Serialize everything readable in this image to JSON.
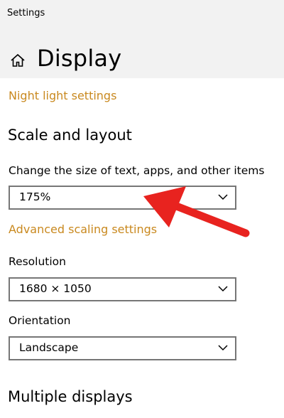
{
  "window": {
    "title": "Settings"
  },
  "header": {
    "title": "Display",
    "home_icon": "home-icon"
  },
  "links": {
    "night_light": "Night light settings",
    "advanced_scaling": "Advanced scaling settings"
  },
  "scale_layout": {
    "section_title": "Scale and layout",
    "scale_label": "Change the size of text, apps, and other items",
    "scale_value": "175%",
    "resolution_label": "Resolution",
    "resolution_value": "1680 × 1050",
    "orientation_label": "Orientation",
    "orientation_value": "Landscape"
  },
  "multiple_displays": {
    "section_title": "Multiple displays"
  },
  "colors": {
    "accent": "#c9891f",
    "header_bg": "#f2f2f2",
    "dropdown_border": "#767676",
    "annotation_arrow": "#e8231f"
  }
}
